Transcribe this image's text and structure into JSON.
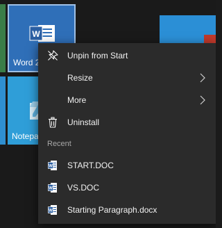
{
  "tiles": {
    "word": {
      "label": "Word 2"
    },
    "notepad": {
      "label": "Notepa"
    }
  },
  "context_menu": {
    "items": [
      {
        "label": "Unpin from Start",
        "icon": "unpin-icon",
        "has_submenu": false
      },
      {
        "label": "Resize",
        "icon": null,
        "has_submenu": true
      },
      {
        "label": "More",
        "icon": null,
        "has_submenu": true
      },
      {
        "label": "Uninstall",
        "icon": "trash-icon",
        "has_submenu": false
      }
    ],
    "recent_header": "Recent",
    "recent_items": [
      {
        "label": "START.DOC",
        "icon": "word-document-icon"
      },
      {
        "label": "VS.DOC",
        "icon": "word-document-icon"
      },
      {
        "label": "Starting Paragraph.docx",
        "icon": "word-document-icon"
      }
    ]
  },
  "colors": {
    "menu_background": "#2b2b2b",
    "word_tile": "#2f6fb8",
    "notepad_tile": "#2f9ed8",
    "section_header": "#a8a8a8"
  }
}
